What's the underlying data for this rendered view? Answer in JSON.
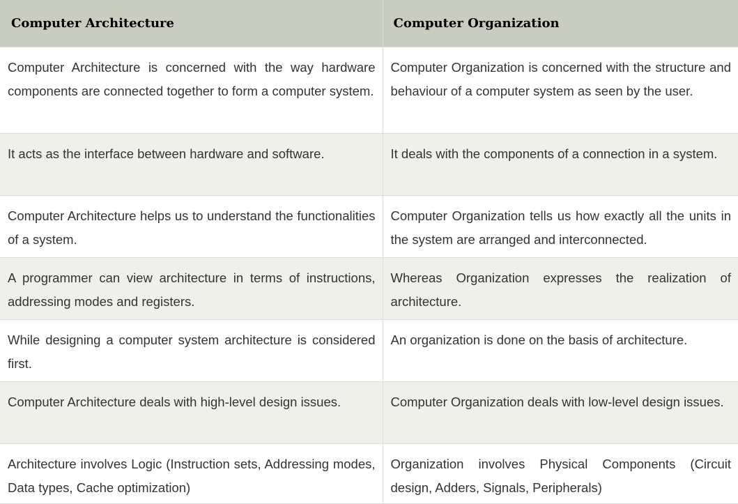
{
  "headers": [
    "Computer Architecture",
    "Computer Organization"
  ],
  "rows": [
    [
      "Computer Architecture is concerned with the way hardware components are connected together to form a computer system.",
      "Computer Organization is concerned with the structure and behaviour of a computer system as seen by the user."
    ],
    [
      "It acts as the interface between hardware and software.",
      "It deals with the components of a connection in a system."
    ],
    [
      "Computer Architecture helps us to understand the functionalities of a system.",
      "Computer Organization tells us how exactly all the units in the system are arranged and interconnected."
    ],
    [
      "A programmer can view architecture in terms of instructions, addressing modes and registers.",
      "Whereas Organization expresses the realization of architecture."
    ],
    [
      "While designing a computer system architecture is considered first.",
      "An organization is done on the basis of architecture."
    ],
    [
      "Computer Architecture deals with high-level design issues.",
      "Computer Organization deals with low-level design issues."
    ],
    [
      "Architecture involves Logic (Instruction sets, Addressing modes, Data types, Cache optimization)",
      "Organization involves Physical Components (Circuit design, Adders, Signals, Peripherals)"
    ]
  ],
  "colors": {
    "header_bg": "#c8cdbf",
    "row_alt_bg": "#eef0e9",
    "row_bg": "#ffffff",
    "text": "#333333",
    "border": "#dcdcdc"
  }
}
